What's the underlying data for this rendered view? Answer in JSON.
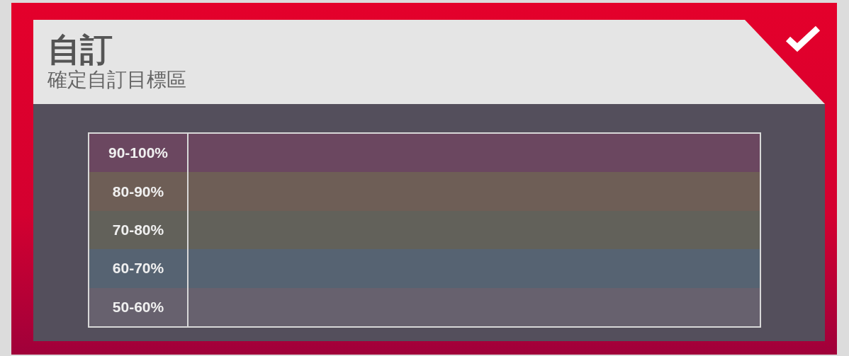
{
  "header": {
    "title": "自訂",
    "subtitle": "確定自訂目標區"
  },
  "zones": [
    {
      "label": "90-100%",
      "color": "#6b4760"
    },
    {
      "label": "80-90%",
      "color": "#6e5e56"
    },
    {
      "label": "70-80%",
      "color": "#62615a"
    },
    {
      "label": "60-70%",
      "color": "#566372"
    },
    {
      "label": "50-60%",
      "color": "#67616e"
    }
  ]
}
